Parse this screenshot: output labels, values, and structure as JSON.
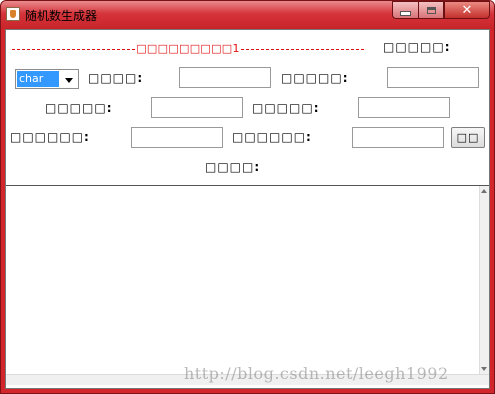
{
  "window": {
    "title": "随机数生成器",
    "close_glyph": "✕"
  },
  "form": {
    "header_text": "□□□□□□□□□1",
    "top_right_label": "□□□□□:",
    "type_select": {
      "value": "char",
      "options": [
        "char"
      ]
    },
    "row1": {
      "label_a": "□□□□:",
      "value_a": "",
      "label_b": "□□□□□:",
      "value_b": ""
    },
    "row2": {
      "label_a": "□□□□□:",
      "value_a": "",
      "label_b": "□□□□□:",
      "value_b": ""
    },
    "row3": {
      "label_a": "□□□□□□:",
      "value_a": "",
      "label_b": "□□□□□□:",
      "value_b": "",
      "button_label": "□□"
    },
    "result_label": "□□□□:"
  },
  "output": {
    "text": ""
  },
  "watermark": "http://blog.csdn.net/leegh1992",
  "colors": {
    "titlebar": "#d3262c",
    "header_text": "#e01010",
    "selection": "#3399ff"
  }
}
